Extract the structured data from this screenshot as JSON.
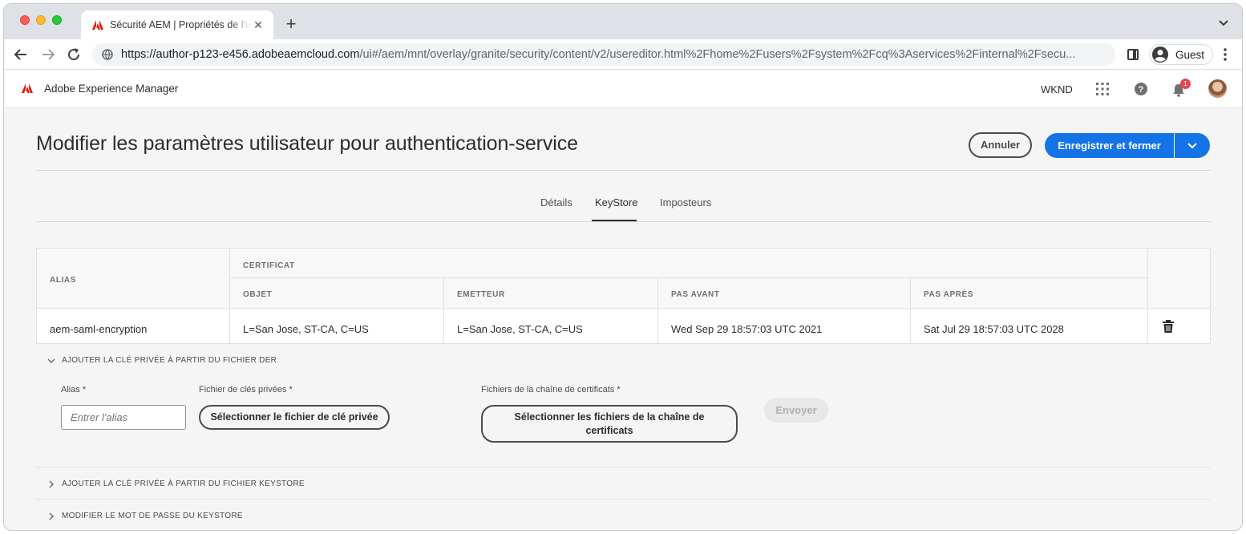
{
  "browser": {
    "tab_title": "Sécurité AEM | Propriétés de l'utilisateur",
    "url_host": "https://author-p123-e456.adobeaemcloud.com",
    "url_path": "/ui#/aem/mnt/overlay/granite/security/content/v2/usereditor.html%2Fhome%2Fusers%2Fsystem%2Fcq%3Aservices%2Finternal%2Fsecu...",
    "profile_label": "Guest",
    "traffic_colors": [
      "#ff5f57",
      "#febc2e",
      "#28c840"
    ]
  },
  "header": {
    "product_name": "Adobe Experience Manager",
    "org": "WKND",
    "notification_count": "1",
    "brand_color": "#eb1000"
  },
  "page": {
    "title": "Modifier les paramètres utilisateur pour authentication-service",
    "cancel_label": "Annuler",
    "save_label": "Enregistrer et fermer",
    "accent": "#1473e6"
  },
  "tabs": [
    {
      "label": "Détails"
    },
    {
      "label": "KeyStore",
      "active": true
    },
    {
      "label": "Imposteurs"
    }
  ],
  "table": {
    "headers": {
      "alias": "ALIAS",
      "certificate": "CERTIFICAT",
      "subject": "OBJET",
      "issuer": "EMETTEUR",
      "not_before": "PAS AVANT",
      "not_after": "PAS APRÈS"
    },
    "rows": [
      {
        "alias": "aem-saml-encryption",
        "subject": "L=San Jose, ST-CA, C=US",
        "issuer": "L=San Jose, ST-CA, C=US",
        "not_before": "Wed Sep 29 18:57:03 UTC 2021",
        "not_after": "Sat Jul 29 18:57:03 UTC 2028"
      }
    ]
  },
  "accordion": {
    "der": {
      "title": "AJOUTER LA CLÉ PRIVÉE À PARTIR DU FICHIER DER",
      "alias_label": "Alias *",
      "alias_placeholder": "Entrer l'alias",
      "private_key_label": "Fichier de clés privées *",
      "private_key_button": "Sélectionner le fichier de clé privée",
      "chain_label": "Fichiers de la chaîne de certificats *",
      "chain_button": "Sélectionner les fichiers de la chaîne de certificats",
      "submit_label": "Envoyer"
    },
    "keystore_file": {
      "title": "AJOUTER LA CLÉ PRIVÉE À PARTIR DU FICHIER KEYSTORE"
    },
    "keystore_password": {
      "title": "MODIFIER LE MOT DE PASSE DU KEYSTORE"
    }
  }
}
